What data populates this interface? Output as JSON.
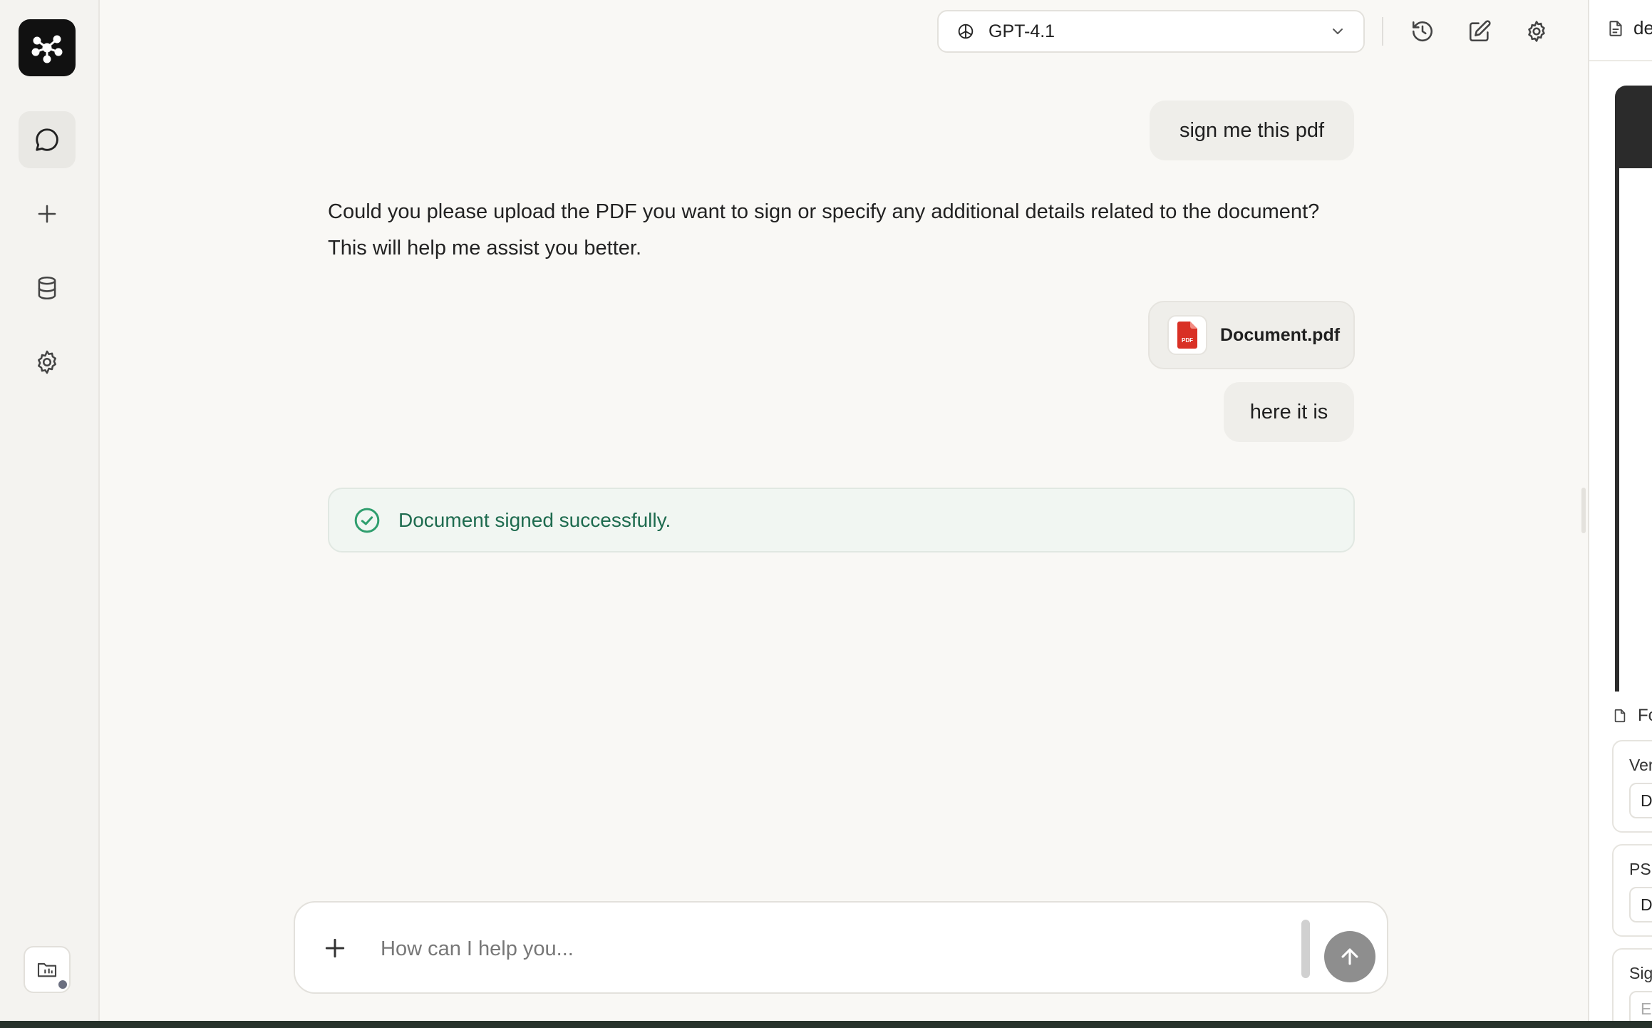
{
  "model_selector": {
    "name": "GPT-4.1"
  },
  "chat": {
    "user_message_1": "sign me this pdf",
    "assistant_message": "Could you please upload the PDF you want to sign or specify any additional details related to the document? This will help me assist you better.",
    "attachment": {
      "file_name": "Document.pdf",
      "file_type_label": "PDF"
    },
    "user_message_2": "here it is",
    "success_message": "Document signed successfully."
  },
  "composer": {
    "placeholder": "How can I help you..."
  },
  "right_panel": {
    "title_partial": "de",
    "form_title_partial": "Fo",
    "fields": [
      {
        "label_partial": "Ver",
        "value_partial": "D"
      },
      {
        "label_partial": "PSI",
        "value_partial": "D"
      },
      {
        "label_partial": "Sig",
        "value_partial": "E"
      }
    ]
  },
  "colors": {
    "accent_success": "#2f9e6e",
    "success_text": "#1e6b4f",
    "pdf_red": "#d93025",
    "send_button": "#8e8e8e"
  }
}
